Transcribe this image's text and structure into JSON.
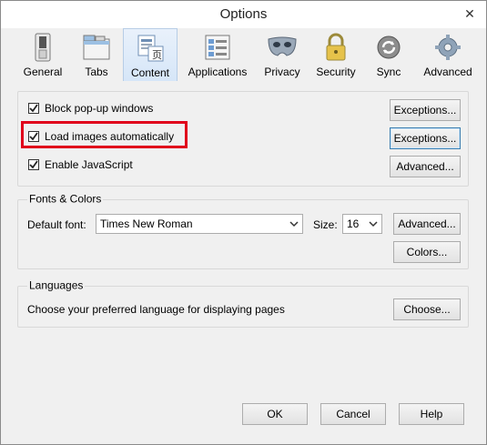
{
  "window": {
    "title": "Options",
    "close_label": "✕"
  },
  "tabs": [
    {
      "label": "General",
      "icon": "general-switch-icon"
    },
    {
      "label": "Tabs",
      "icon": "tabs-window-icon"
    },
    {
      "label": "Content",
      "icon": "content-page-icon",
      "selected": true
    },
    {
      "label": "Applications",
      "icon": "applications-list-icon"
    },
    {
      "label": "Privacy",
      "icon": "privacy-mask-icon"
    },
    {
      "label": "Security",
      "icon": "security-lock-icon"
    },
    {
      "label": "Sync",
      "icon": "sync-arrows-icon"
    },
    {
      "label": "Advanced",
      "icon": "advanced-gear-icon"
    }
  ],
  "content": {
    "block_popups": {
      "label": "Block pop-up windows",
      "checked": true,
      "button": "Exceptions..."
    },
    "load_images": {
      "label": "Load images automatically",
      "checked": true,
      "button": "Exceptions..."
    },
    "enable_js": {
      "label": "Enable JavaScript",
      "checked": true,
      "button": "Advanced..."
    }
  },
  "fonts": {
    "group_label": "Fonts & Colors",
    "default_font_label": "Default font:",
    "default_font_value": "Times New Roman",
    "size_label": "Size:",
    "size_value": "16",
    "advanced_button": "Advanced...",
    "colors_button": "Colors..."
  },
  "languages": {
    "group_label": "Languages",
    "description": "Choose your preferred language for displaying pages",
    "choose_button": "Choose..."
  },
  "footer": {
    "ok": "OK",
    "cancel": "Cancel",
    "help": "Help"
  },
  "colors": {
    "highlight": "#e0001b",
    "selected_tab": "#d6e6f8"
  }
}
